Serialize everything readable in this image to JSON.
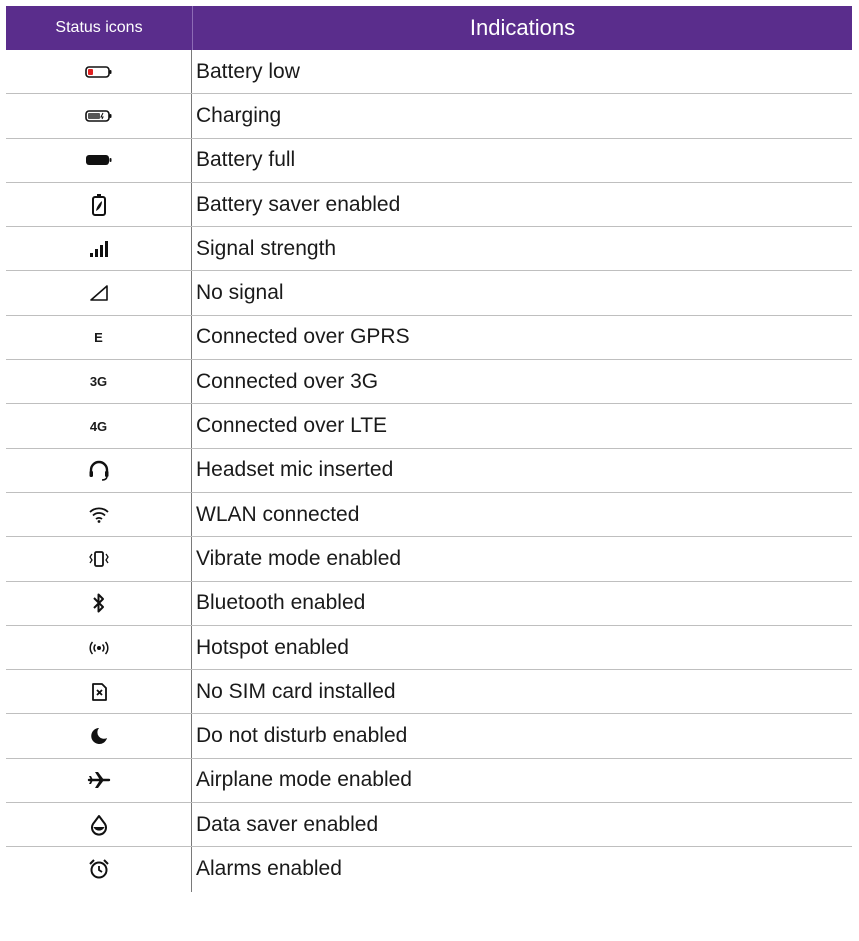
{
  "header": {
    "col_icons": "Status icons",
    "col_indications": "Indications"
  },
  "rows": [
    {
      "icon": "battery-low-icon",
      "icon_text": "",
      "label": "Battery low"
    },
    {
      "icon": "battery-charging-icon",
      "icon_text": "",
      "label": "Charging"
    },
    {
      "icon": "battery-full-icon",
      "icon_text": "",
      "label": "Battery full"
    },
    {
      "icon": "battery-saver-icon",
      "icon_text": "",
      "label": "Battery saver enabled"
    },
    {
      "icon": "signal-strength-icon",
      "icon_text": "",
      "label": "Signal strength"
    },
    {
      "icon": "no-signal-icon",
      "icon_text": "",
      "label": "No signal"
    },
    {
      "icon": "gprs-icon",
      "icon_text": "E",
      "label": "Connected over GPRS"
    },
    {
      "icon": "3g-icon",
      "icon_text": "3G",
      "label": "Connected over 3G"
    },
    {
      "icon": "4g-icon",
      "icon_text": "4G",
      "label": "Connected over LTE"
    },
    {
      "icon": "headset-icon",
      "icon_text": "",
      "label": "Headset mic inserted"
    },
    {
      "icon": "wifi-icon",
      "icon_text": "",
      "label": "WLAN connected"
    },
    {
      "icon": "vibrate-icon",
      "icon_text": "",
      "label": "Vibrate mode enabled"
    },
    {
      "icon": "bluetooth-icon",
      "icon_text": "",
      "label": "Bluetooth enabled"
    },
    {
      "icon": "hotspot-icon",
      "icon_text": "",
      "label": "Hotspot enabled"
    },
    {
      "icon": "no-sim-icon",
      "icon_text": "",
      "label": "No SIM card installed"
    },
    {
      "icon": "moon-icon",
      "icon_text": "",
      "label": "Do not disturb enabled"
    },
    {
      "icon": "airplane-icon",
      "icon_text": "",
      "label": "Airplane mode enabled"
    },
    {
      "icon": "data-saver-icon",
      "icon_text": "",
      "label": "Data saver enabled"
    },
    {
      "icon": "alarm-icon",
      "icon_text": "",
      "label": "Alarms enabled"
    }
  ],
  "colors": {
    "header_bg": "#5a2d8c",
    "battery_low": "#e02020"
  }
}
